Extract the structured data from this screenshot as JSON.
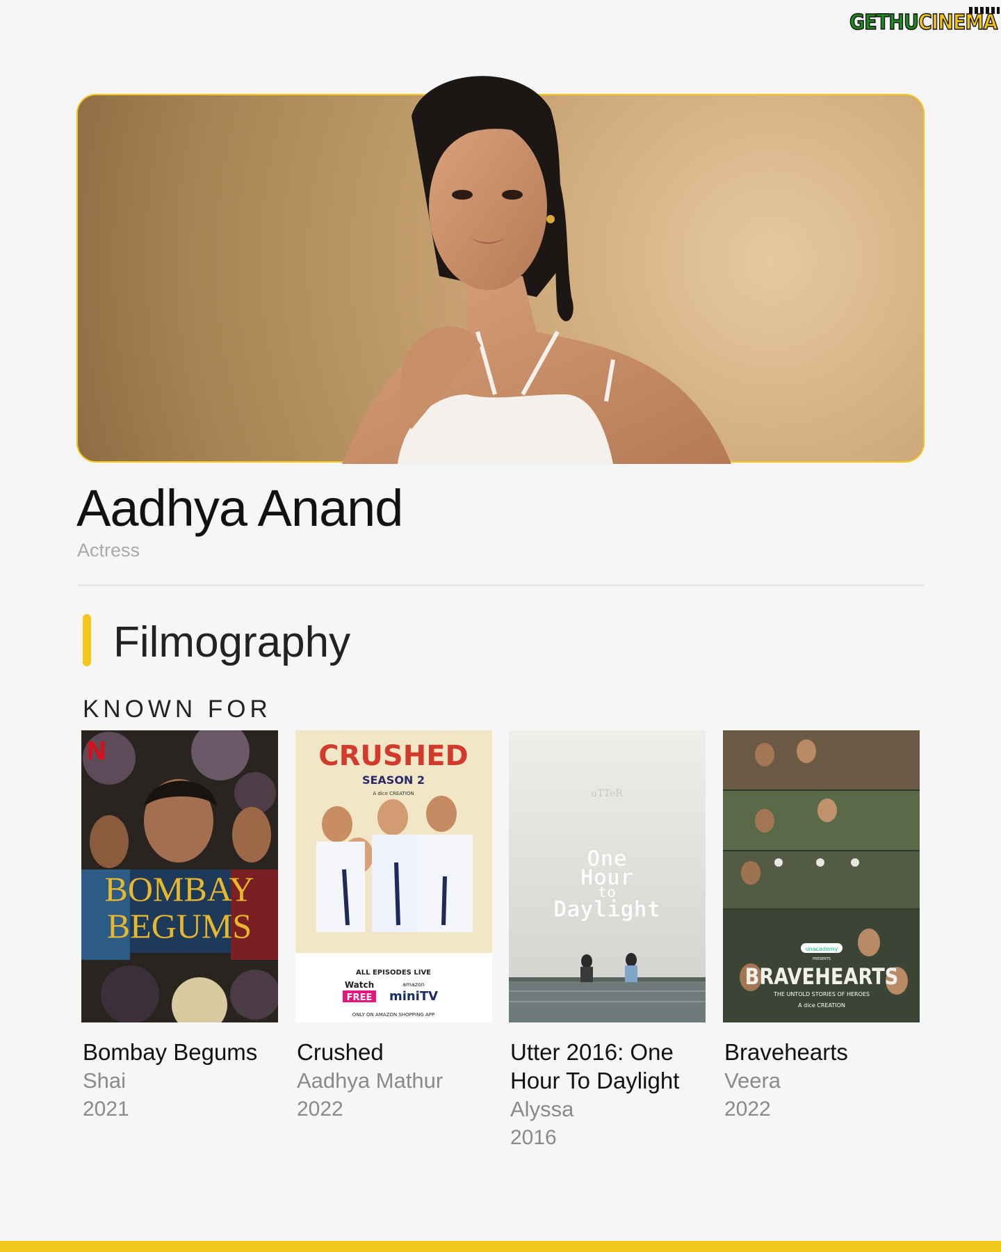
{
  "watermark": {
    "part1": "GETHU",
    "part2": "CINEMA"
  },
  "profile": {
    "name": "Aadhya Anand",
    "role": "Actress"
  },
  "filmography": {
    "section_title": "Filmography",
    "known_for_label": "KNOWN FOR",
    "items": [
      {
        "title": "Bombay Begums",
        "role": "Shai",
        "year": "2021",
        "poster": {
          "line1": "BOMBAY",
          "line2": "BEGUMS",
          "badge": "N"
        }
      },
      {
        "title": "Crushed",
        "role": "Aadhya Mathur",
        "year": "2022",
        "poster": {
          "title": "CRUSHED",
          "subtitle": "SEASON 2",
          "credit": "A dice CREATION",
          "episodes": "ALL EPISODES LIVE",
          "watch": "Watch",
          "free": "FREE",
          "amazon": "amazon",
          "platform": "miniTV",
          "footer": "ONLY ON AMAZON SHOPPING APP"
        }
      },
      {
        "title": "Utter 2016: One Hour To Daylight",
        "role": "Alyssa",
        "year": "2016",
        "poster": {
          "brand": "uTTeR",
          "line1": "One",
          "line2": "Hour",
          "line3": "to",
          "line4": "Daylight"
        }
      },
      {
        "title": "Bravehearts",
        "role": "Veera",
        "year": "2022",
        "poster": {
          "sponsor": "unacademy",
          "presents": "PRESENTS",
          "title": "BRAVEHEARTS",
          "tagline": "THE UNTOLD STORIES OF HEROES",
          "credit": "A dice CREATION"
        }
      }
    ]
  },
  "colors": {
    "accent": "#f0c71a",
    "text_primary": "#111111",
    "text_secondary": "#8a8a8a",
    "background": "#f6f6f6"
  }
}
